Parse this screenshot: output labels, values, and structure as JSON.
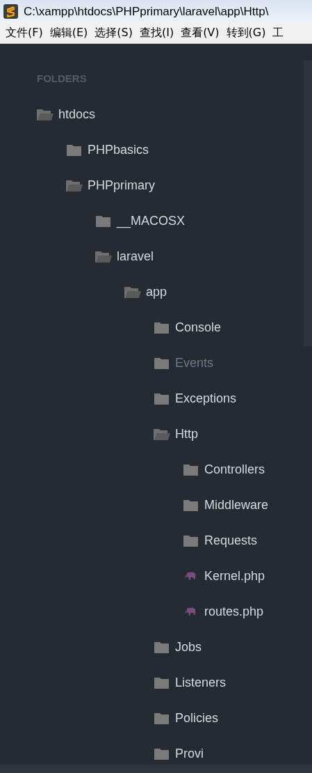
{
  "window": {
    "title": "C:\\xampp\\htdocs\\PHPprimary\\laravel\\app\\Http\\"
  },
  "menu": [
    "文件(F)",
    "编辑(E)",
    "选择(S)",
    "查找(I)",
    "查看(V)",
    "转到(G)",
    "工"
  ],
  "sidebar": {
    "header": "FOLDERS",
    "tree": [
      {
        "kind": "folder",
        "label": "htdocs",
        "expanded": true,
        "children": [
          {
            "kind": "folder",
            "label": "PHPbasics",
            "expanded": false
          },
          {
            "kind": "folder",
            "label": "PHPprimary",
            "expanded": true,
            "children": [
              {
                "kind": "folder",
                "label": "__MACOSX",
                "expanded": false
              },
              {
                "kind": "folder",
                "label": "laravel",
                "expanded": true,
                "children": [
                  {
                    "kind": "folder",
                    "label": "app",
                    "expanded": true,
                    "children": [
                      {
                        "kind": "folder",
                        "label": "Console",
                        "expanded": false,
                        "dimmed": false
                      },
                      {
                        "kind": "folder",
                        "label": "Events",
                        "expanded": false,
                        "dimmed": true
                      },
                      {
                        "kind": "folder",
                        "label": "Exceptions",
                        "expanded": false,
                        "dimmed": false
                      },
                      {
                        "kind": "folder",
                        "label": "Http",
                        "expanded": true,
                        "dimmed": false,
                        "children": [
                          {
                            "kind": "folder",
                            "label": "Controllers",
                            "expanded": false
                          },
                          {
                            "kind": "folder",
                            "label": "Middleware",
                            "expanded": false
                          },
                          {
                            "kind": "folder",
                            "label": "Requests",
                            "expanded": false
                          },
                          {
                            "kind": "file",
                            "label": "Kernel.php"
                          },
                          {
                            "kind": "file",
                            "label": "routes.php"
                          }
                        ]
                      },
                      {
                        "kind": "folder",
                        "label": "Jobs",
                        "expanded": false,
                        "dimmed": false
                      },
                      {
                        "kind": "folder",
                        "label": "Listeners",
                        "expanded": false,
                        "dimmed": false
                      },
                      {
                        "kind": "folder",
                        "label": "Policies",
                        "expanded": false,
                        "dimmed": false
                      },
                      {
                        "kind": "folder",
                        "label": "Provi",
                        "expanded": false,
                        "dimmed": false
                      }
                    ]
                  }
                ]
              }
            ]
          }
        ]
      }
    ]
  }
}
